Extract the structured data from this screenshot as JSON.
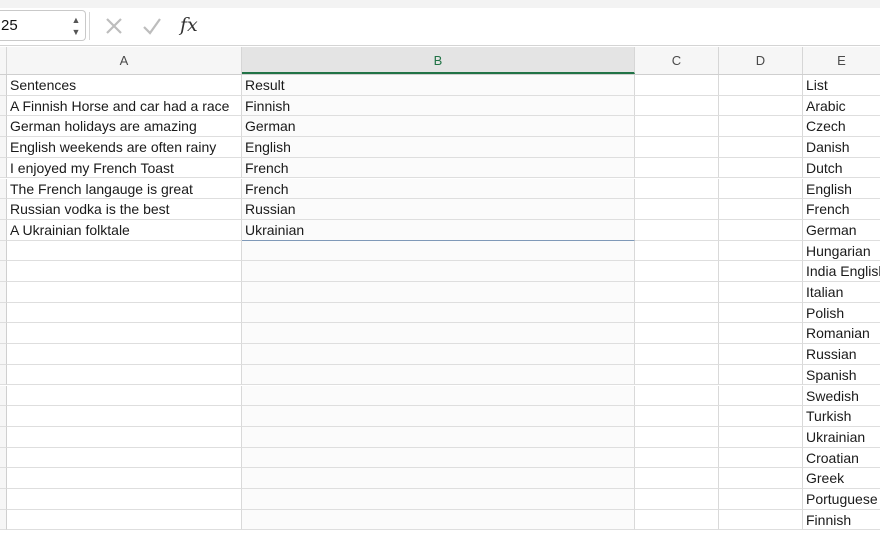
{
  "formula_bar": {
    "name_box": "25",
    "cancel_icon": "x-icon",
    "enter_icon": "checkmark-icon",
    "function_label": "fx",
    "formula": ""
  },
  "columns": [
    "A",
    "B",
    "C",
    "D",
    "E"
  ],
  "selected_column": "B",
  "accent_color": "#217346",
  "sheet": {
    "header": {
      "a": "Sentences",
      "b": "Result",
      "e": "List"
    },
    "rows": [
      {
        "a": "A Finnish Horse and car had a race",
        "b": "Finnish",
        "e": "Arabic"
      },
      {
        "a": "German holidays are amazing",
        "b": "German",
        "e": "Czech"
      },
      {
        "a": "English weekends are often rainy",
        "b": "English",
        "e": "Danish"
      },
      {
        "a": "I enjoyed my French Toast",
        "b": "French",
        "e": "Dutch"
      },
      {
        "a": "The French langauge is great",
        "b": "French",
        "e": "English"
      },
      {
        "a": "Russian vodka is the best",
        "b": "Russian",
        "e": "French"
      },
      {
        "a": "A Ukrainian folktale",
        "b": "Ukrainian",
        "e": "German"
      },
      {
        "a": "",
        "b": "",
        "e": "Hungarian"
      },
      {
        "a": "",
        "b": "",
        "e": "India English"
      },
      {
        "a": "",
        "b": "",
        "e": "Italian"
      },
      {
        "a": "",
        "b": "",
        "e": "Polish"
      },
      {
        "a": "",
        "b": "",
        "e": "Romanian"
      },
      {
        "a": "",
        "b": "",
        "e": "Russian"
      },
      {
        "a": "",
        "b": "",
        "e": "Spanish"
      },
      {
        "a": "",
        "b": "",
        "e": "Swedish"
      },
      {
        "a": "",
        "b": "",
        "e": "Turkish"
      },
      {
        "a": "",
        "b": "",
        "e": "Ukrainian"
      },
      {
        "a": "",
        "b": "",
        "e": "Croatian"
      },
      {
        "a": "",
        "b": "",
        "e": "Greek"
      },
      {
        "a": "",
        "b": "",
        "e": "Portuguese"
      },
      {
        "a": "",
        "b": "",
        "e": "Finnish"
      }
    ]
  }
}
